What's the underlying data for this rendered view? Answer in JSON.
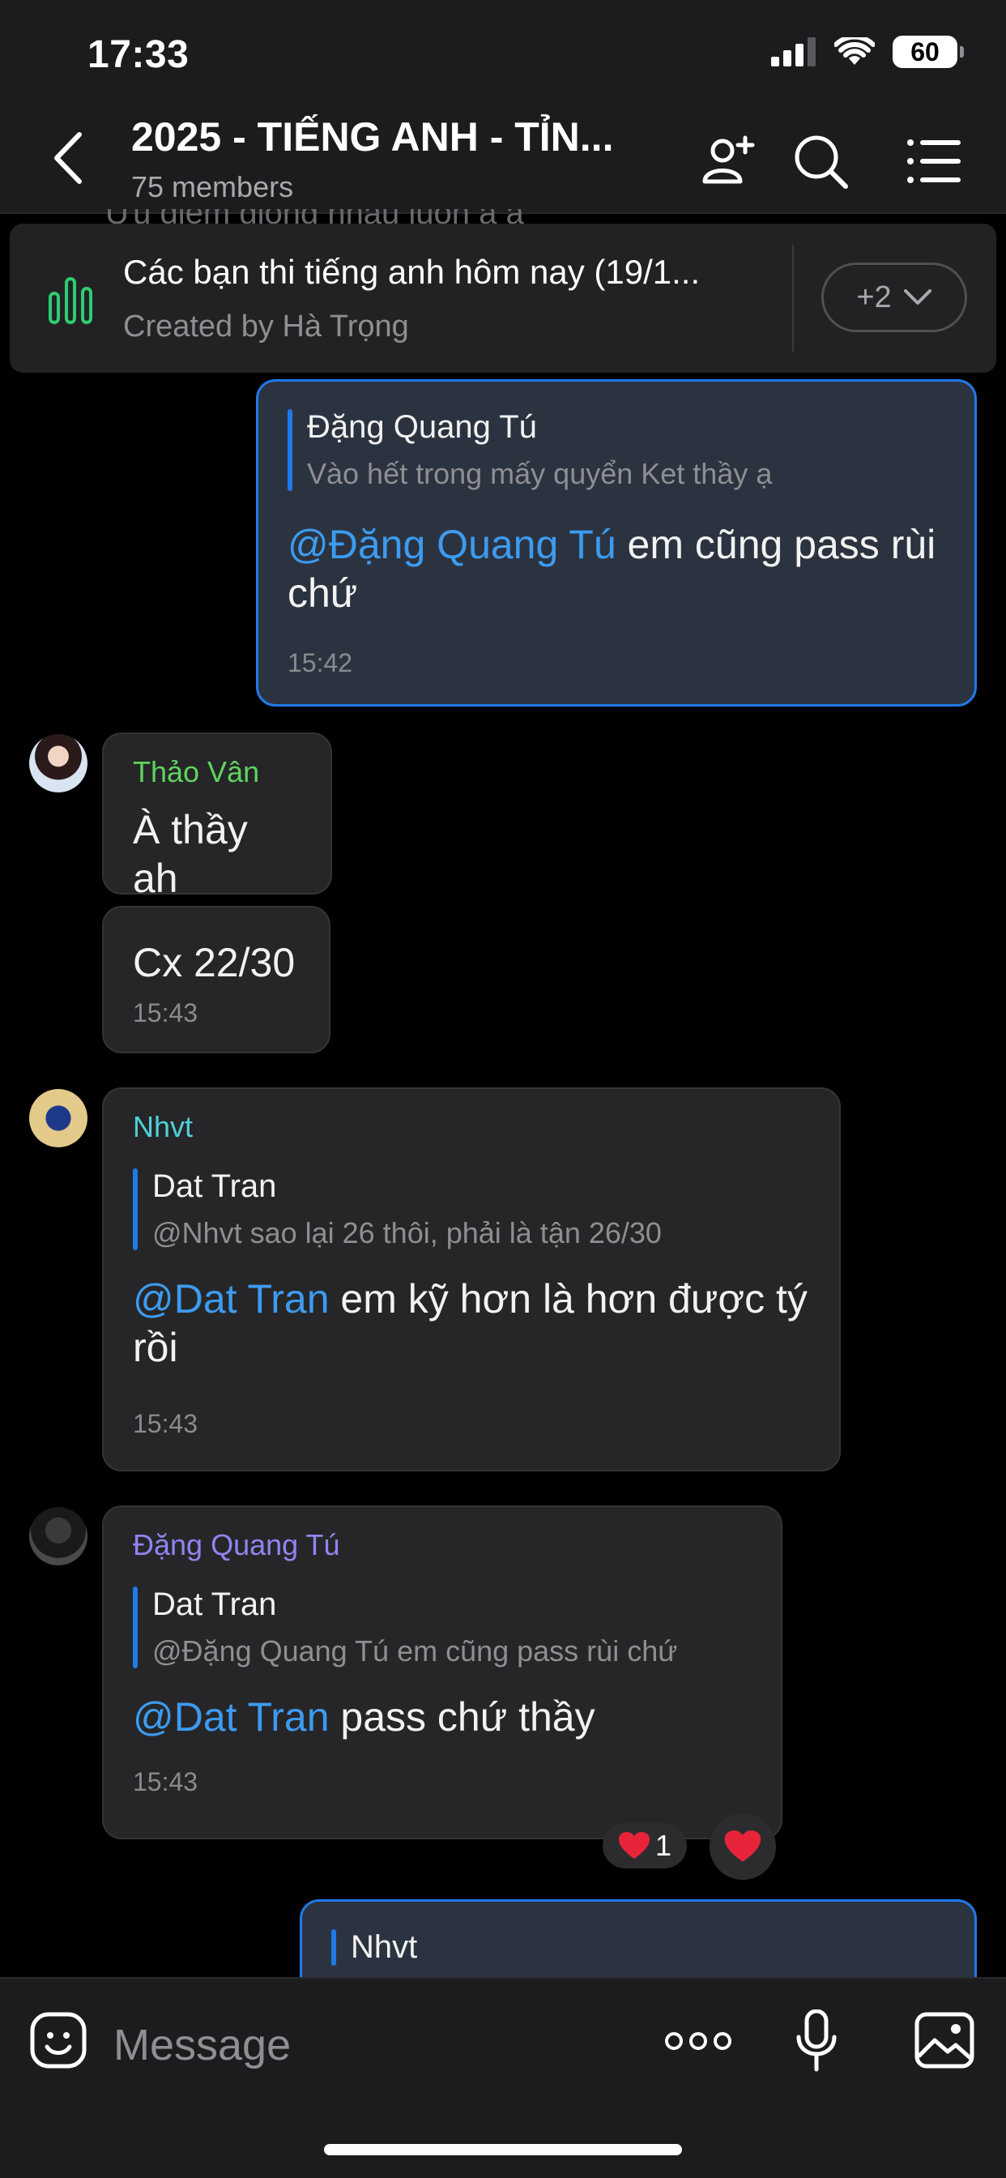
{
  "status": {
    "time": "17:33",
    "battery": "60"
  },
  "header": {
    "title": "2025 - TIẾNG ANH - TỈN...",
    "subtitle": "75 members"
  },
  "pinned": {
    "ghost_text": "Ưu điểm giống nhau luôn ạ ạ",
    "title": "Các bạn thi tiếng anh hôm nay (19/1...",
    "subtitle": "Created by Hà Trọng",
    "more_label": "+2"
  },
  "messages": {
    "m1": {
      "quote_name": "Đặng Quang Tú",
      "quote_text": "Vào hết trong mấy quyển Ket thầy ạ",
      "mention": "@Đặng Quang Tú",
      "text": " em cũng pass rùi chứ",
      "time": "15:42"
    },
    "m2": {
      "sender": "Thảo Vân",
      "sender_color": "#5fd35f",
      "text": "À thầy ah"
    },
    "m3": {
      "text": "Cx 22/30",
      "time": "15:43"
    },
    "m4": {
      "sender": "Nhvt",
      "sender_color": "#4fd1d9",
      "quote_name": "Dat Tran",
      "quote_text": "@Nhvt sao lại 26 thôi, phải là tận 26/30",
      "mention": "@Dat Tran",
      "text": " em kỹ hơn là hơn được tý rồi",
      "time": "15:43"
    },
    "m5": {
      "sender": "Đặng Quang Tú",
      "sender_color": "#8f85f2",
      "quote_name": "Dat Tran",
      "quote_text": "@Đặng Quang Tú em cũng pass rùi chứ",
      "mention": "@Dat Tran",
      "text": " pass chứ thầy",
      "time": "15:43",
      "reaction_count": "1"
    },
    "m6": {
      "quote_name": "Nhvt"
    }
  },
  "input": {
    "placeholder": "Message"
  },
  "icons": {
    "back": "chevron-left-icon",
    "add_member": "add-member-icon",
    "search": "search-icon",
    "menu": "list-menu-icon",
    "poll": "poll-icon",
    "sticker": "sticker-icon",
    "more": "more-dots-icon",
    "mic": "microphone-icon",
    "gallery": "image-icon",
    "heart": "heart-icon"
  },
  "colors": {
    "accent": "#1f7ae8",
    "mention": "#3d9bf0",
    "poll": "#2ecc71"
  }
}
